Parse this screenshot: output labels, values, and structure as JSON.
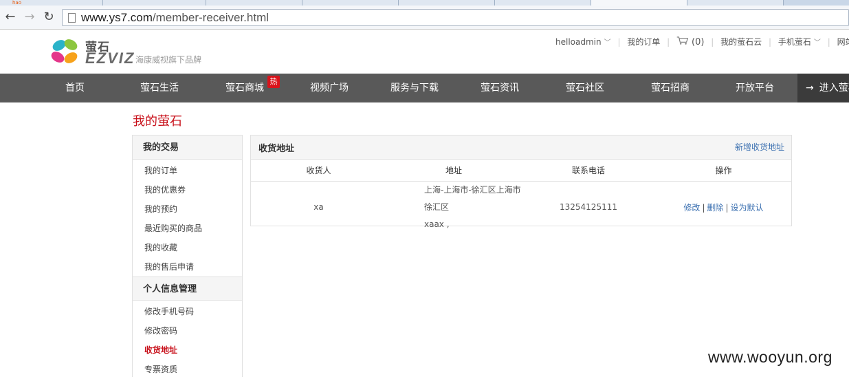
{
  "browser": {
    "tabs": [
      "hao",
      "",
      "",
      "",
      "",
      "",
      "",
      "",
      ""
    ],
    "url_domain": "www.ys7.com",
    "url_path": "/member-receiver.html"
  },
  "header": {
    "logo_cn": "萤石",
    "logo_en": "EZVIZ",
    "slogan": "海康威视旗下品牌",
    "username": "helloadmin",
    "my_orders": "我的订单",
    "cart_count": "(0)",
    "my_cloud": "我的萤石云",
    "mobile": "手机萤石",
    "site_nav": "网站导航"
  },
  "nav": {
    "items": [
      "首页",
      "萤石生活",
      "萤石商城",
      "视频广场",
      "服务与下载",
      "萤石资讯",
      "萤石社区",
      "萤石招商",
      "开放平台"
    ],
    "hot_badge": "热",
    "enter_label": "进入萤石云"
  },
  "page": {
    "title": "我的萤石"
  },
  "sidebar": {
    "section1_title": "我的交易",
    "section1_items": [
      "我的订单",
      "我的优惠券",
      "我的预约",
      "最近购买的商品",
      "我的收藏",
      "我的售后申请"
    ],
    "section2_title": "个人信息管理",
    "section2_items": [
      "修改手机号码",
      "修改密码",
      "收货地址",
      "专票资质"
    ]
  },
  "panel": {
    "title": "收货地址",
    "add_link": "新增收货地址",
    "columns": [
      "收货人",
      "地址",
      "联系电话",
      "操作"
    ],
    "rows": [
      {
        "receiver": "xa",
        "address_line1": "上海-上海市-徐汇区上海市徐汇区",
        "address_line2": "xaax ,",
        "phone": "13254125111",
        "op_edit": "修改",
        "op_delete": "删除",
        "op_default": "设为默认",
        "sep": "|"
      }
    ]
  },
  "watermark": "www.wooyun.org",
  "colors": {
    "brand_red": "#c8101a",
    "nav_bg": "#595959",
    "link_blue": "#3a6fb0"
  }
}
